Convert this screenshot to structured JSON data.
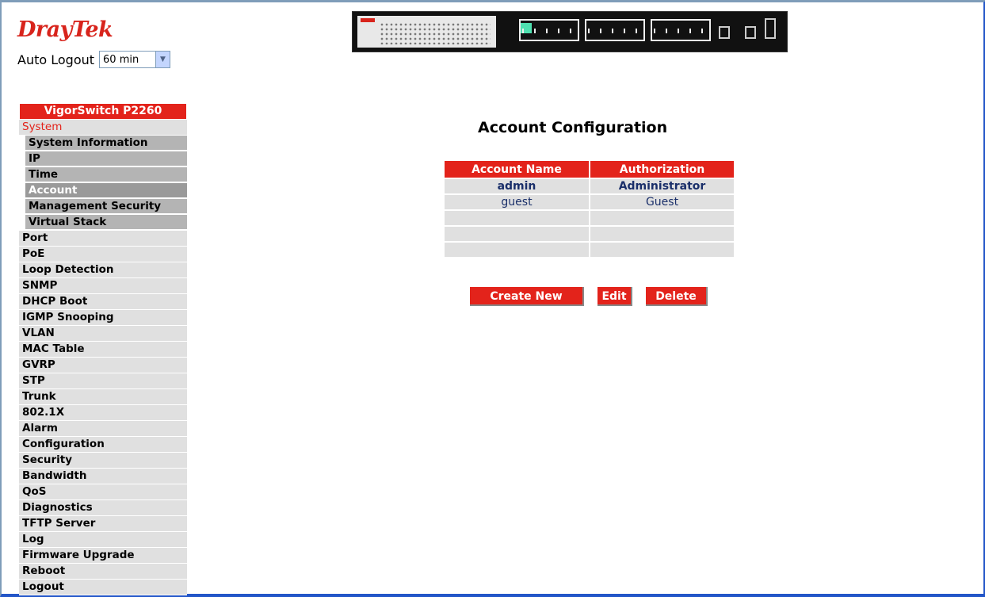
{
  "brand": {
    "logo_text": "DrayTek"
  },
  "auto_logout": {
    "label": "Auto Logout",
    "value": "60 min"
  },
  "sidebar": {
    "device_title": "VigorSwitch P2260",
    "open_group": "System",
    "sub_items": [
      {
        "label": "System Information",
        "active": false
      },
      {
        "label": "IP",
        "active": false
      },
      {
        "label": "Time",
        "active": false
      },
      {
        "label": "Account",
        "active": true
      },
      {
        "label": "Management Security",
        "active": false
      },
      {
        "label": "Virtual Stack",
        "active": false
      }
    ],
    "items": [
      "Port",
      "PoE",
      "Loop Detection",
      "SNMP",
      "DHCP Boot",
      "IGMP Snooping",
      "VLAN",
      "MAC Table",
      "GVRP",
      "STP",
      "Trunk",
      "802.1X",
      "Alarm",
      "Configuration",
      "Security",
      "Bandwidth",
      "QoS",
      "Diagnostics",
      "TFTP Server",
      "Log",
      "Firmware Upgrade",
      "Reboot",
      "Logout"
    ]
  },
  "main": {
    "title": "Account Configuration",
    "table": {
      "headers": [
        "Account Name",
        "Authorization"
      ],
      "rows": [
        [
          "admin",
          "Administrator"
        ],
        [
          "guest",
          "Guest"
        ],
        [
          "",
          ""
        ],
        [
          "",
          ""
        ],
        [
          "",
          ""
        ]
      ]
    },
    "buttons": {
      "create": "Create New",
      "edit": "Edit",
      "delete": "Delete"
    }
  },
  "colors": {
    "accent": "#e3231b",
    "menu_bg": "#e0e0e0",
    "submenu_bg": "#b4b4b4",
    "window_border": "#2356c8"
  }
}
